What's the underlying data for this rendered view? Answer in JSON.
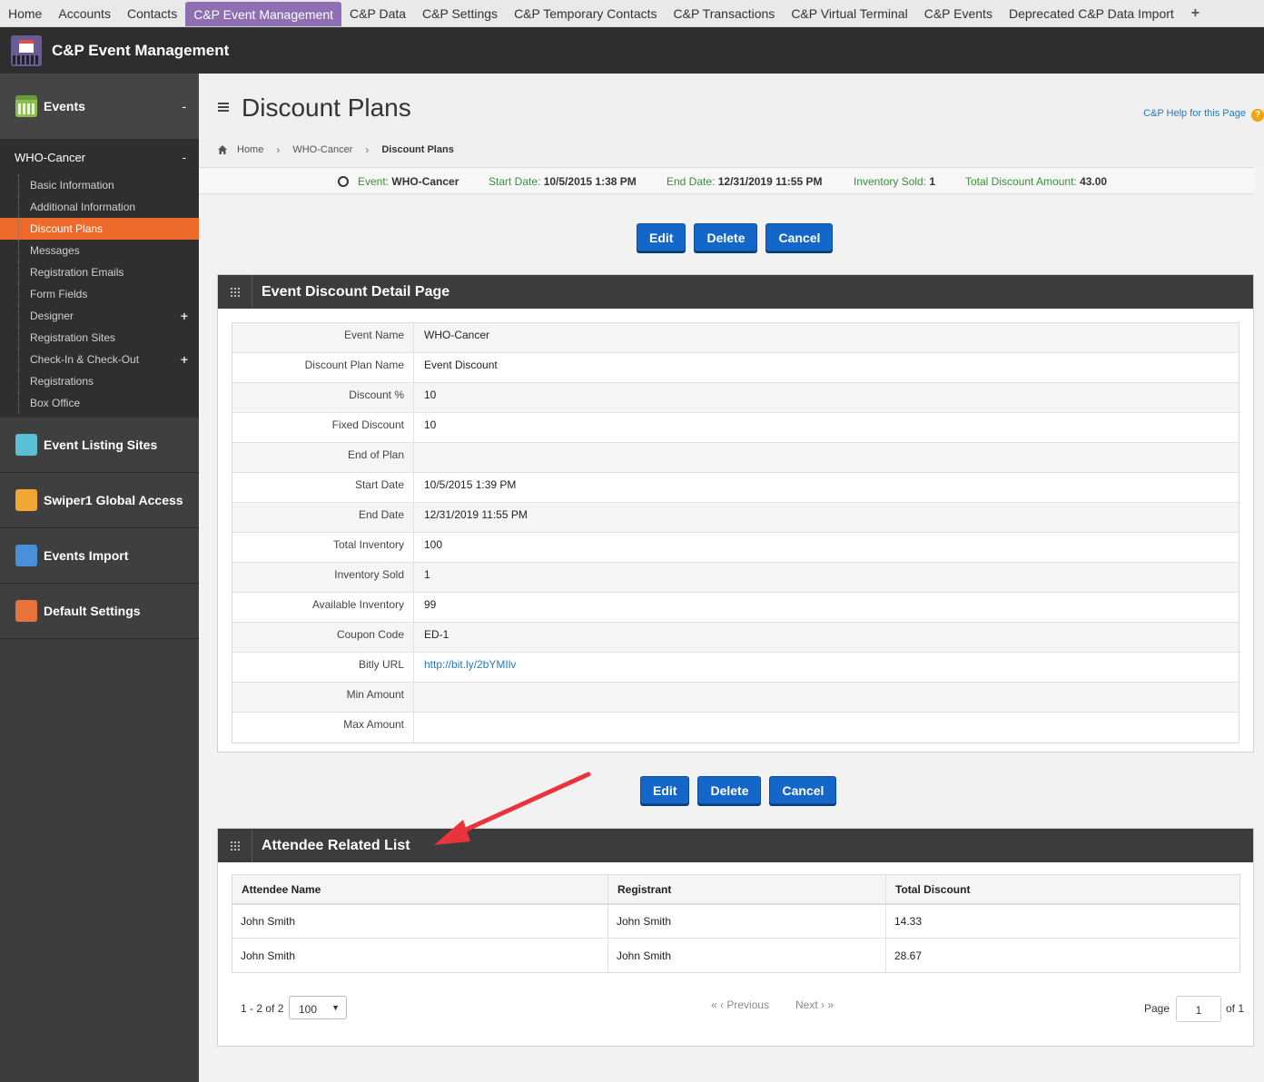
{
  "topnav": {
    "tabs": [
      "Home",
      "Accounts",
      "Contacts",
      "C&P Event Management",
      "C&P Data",
      "C&P Settings",
      "C&P Temporary Contacts",
      "C&P Transactions",
      "C&P Virtual Terminal",
      "C&P Events",
      "Deprecated C&P Data Import"
    ],
    "active_index": 3,
    "plus": "+"
  },
  "app": {
    "title": "C&P Event Management"
  },
  "sidebar": {
    "events_label": "Events",
    "events_toggle": "-",
    "event_name": "WHO-Cancer",
    "event_toggle": "-",
    "items": [
      {
        "label": "Basic Information",
        "toggle": ""
      },
      {
        "label": "Additional Information",
        "toggle": ""
      },
      {
        "label": "Discount Plans",
        "toggle": "",
        "active": true
      },
      {
        "label": "Messages",
        "toggle": ""
      },
      {
        "label": "Registration Emails",
        "toggle": ""
      },
      {
        "label": "Form Fields",
        "toggle": ""
      },
      {
        "label": "Designer",
        "toggle": "+"
      },
      {
        "label": "Registration Sites",
        "toggle": ""
      },
      {
        "label": "Check-In & Check-Out",
        "toggle": "+"
      },
      {
        "label": "Registrations",
        "toggle": ""
      },
      {
        "label": "Box Office",
        "toggle": ""
      }
    ],
    "sections": [
      {
        "label": "Event Listing Sites",
        "icon": "listing-sites-icon",
        "color": "#5bbfd6"
      },
      {
        "label": "Swiper1 Global Access",
        "icon": "swiper-icon",
        "color": "#f0a830"
      },
      {
        "label": "Events Import",
        "icon": "events-import-icon",
        "color": "#4a90d9"
      },
      {
        "label": "Default Settings",
        "icon": "default-settings-icon",
        "color": "#e8733a"
      }
    ]
  },
  "page": {
    "title": "Discount Plans",
    "help": "C&P Help for this Page",
    "help_icon": "?",
    "breadcrumbs": [
      "Home",
      "WHO-Cancer",
      "Discount Plans"
    ],
    "crumb_sep": "›"
  },
  "infobar": {
    "event_label": "Event:",
    "event_value": "WHO-Cancer",
    "start_label": "Start Date:",
    "start_value": "10/5/2015 1:38 PM",
    "end_label": "End Date:",
    "end_value": "12/31/2019 11:55 PM",
    "sold_label": "Inventory Sold:",
    "sold_value": "1",
    "total_label": "Total Discount Amount:",
    "total_value": "43.00"
  },
  "buttons": {
    "edit": "Edit",
    "delete": "Delete",
    "cancel": "Cancel"
  },
  "detail": {
    "title": "Event Discount Detail Page",
    "rows": [
      {
        "k": "Event Name",
        "v": "WHO-Cancer"
      },
      {
        "k": "Discount Plan Name",
        "v": "Event Discount"
      },
      {
        "k": "Discount %",
        "v": "10"
      },
      {
        "k": "Fixed Discount",
        "v": "10"
      },
      {
        "k": "End of Plan",
        "v": ""
      },
      {
        "k": "Start Date",
        "v": "10/5/2015 1:39 PM"
      },
      {
        "k": "End Date",
        "v": "12/31/2019 11:55 PM"
      },
      {
        "k": "Total Inventory",
        "v": "100"
      },
      {
        "k": "Inventory Sold",
        "v": "1"
      },
      {
        "k": "Available Inventory",
        "v": "99"
      },
      {
        "k": "Coupon Code",
        "v": "ED-1"
      },
      {
        "k": "Bitly URL",
        "v": "http://bit.ly/2bYMIlv",
        "link": true
      },
      {
        "k": "Min Amount",
        "v": ""
      },
      {
        "k": "Max Amount",
        "v": ""
      }
    ]
  },
  "attendees": {
    "title": "Attendee Related List",
    "columns": [
      "Attendee Name",
      "Registrant",
      "Total Discount"
    ],
    "rows": [
      [
        "John Smith",
        "John Smith",
        "14.33"
      ],
      [
        "John Smith",
        "John Smith",
        "28.67"
      ]
    ],
    "count": "1 - 2 of 2",
    "page_size": "100",
    "previous": "Previous",
    "next": "Next",
    "page_label": "Page",
    "page_value": "1",
    "of": "of 1"
  },
  "colors": {
    "accent": "#1566c9",
    "active_tab": "#8f6fb3",
    "active_nav": "#ee6a2b"
  }
}
